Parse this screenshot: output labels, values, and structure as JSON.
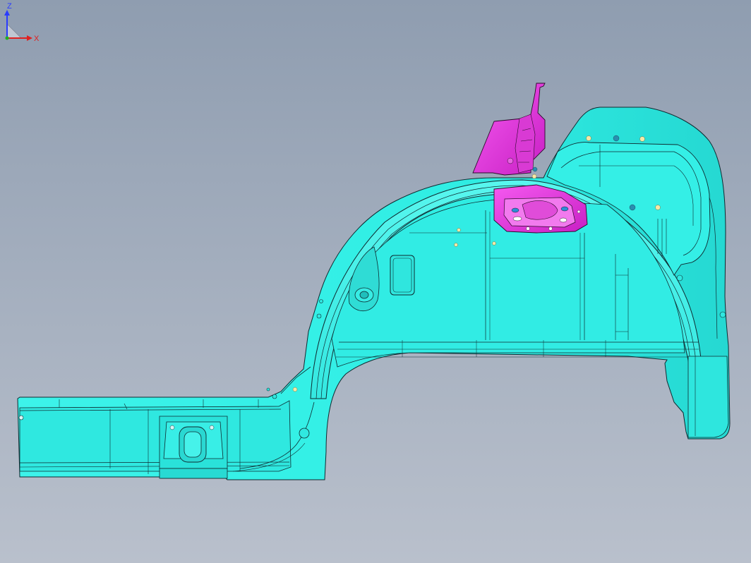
{
  "viewport": {
    "background_top": "#8f9db0",
    "background_bottom": "#b9c0cc",
    "body_color": "#33f0e6",
    "edge_color": "#0f2a30",
    "bracket_color": "#ee2ee8",
    "fastener_colors": [
      "#f5e8a8",
      "#2a8fb0"
    ]
  },
  "triad": {
    "z_label": "Z",
    "x_label": "X",
    "z_color": "#2a3cff",
    "x_color": "#e02020",
    "y_color": "#20b020"
  }
}
